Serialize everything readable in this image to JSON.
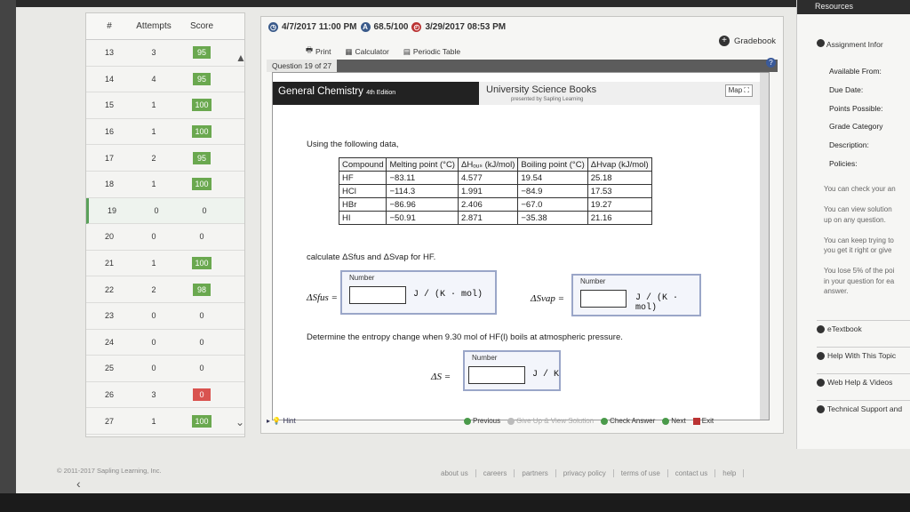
{
  "attempts_panel": {
    "headers": {
      "number": "#",
      "attempts": "Attempts",
      "score": "Score"
    },
    "rows": [
      {
        "n": "13",
        "attempts": "3",
        "score": "95",
        "status": "green"
      },
      {
        "n": "14",
        "attempts": "4",
        "score": "95",
        "status": "green"
      },
      {
        "n": "15",
        "attempts": "1",
        "score": "100",
        "status": "green"
      },
      {
        "n": "16",
        "attempts": "1",
        "score": "100",
        "status": "green"
      },
      {
        "n": "17",
        "attempts": "2",
        "score": "95",
        "status": "green"
      },
      {
        "n": "18",
        "attempts": "1",
        "score": "100",
        "status": "green"
      },
      {
        "n": "19",
        "attempts": "0",
        "score": "0",
        "status": "none"
      },
      {
        "n": "20",
        "attempts": "0",
        "score": "0",
        "status": "none"
      },
      {
        "n": "21",
        "attempts": "1",
        "score": "100",
        "status": "green"
      },
      {
        "n": "22",
        "attempts": "2",
        "score": "98",
        "status": "green"
      },
      {
        "n": "23",
        "attempts": "0",
        "score": "0",
        "status": "none"
      },
      {
        "n": "24",
        "attempts": "0",
        "score": "0",
        "status": "none"
      },
      {
        "n": "25",
        "attempts": "0",
        "score": "0",
        "status": "none"
      },
      {
        "n": "26",
        "attempts": "3",
        "score": "0",
        "status": "red"
      },
      {
        "n": "27",
        "attempts": "1",
        "score": "100",
        "status": "green"
      }
    ]
  },
  "question_header": {
    "due_date": "4/7/2017 11:00 PM",
    "score": "68.5/100",
    "last_date": "3/29/2017 08:53 PM",
    "print": "Print",
    "calculator": "Calculator",
    "periodic_table": "Periodic Table",
    "gradebook": "Gradebook",
    "question_label": "Question 19 of 27"
  },
  "book": {
    "title": "General Chemistry",
    "edition": "4th Edition",
    "publisher": "University Science Books",
    "publisher_sub": "presented by Sapling Learning",
    "map": "Map"
  },
  "question": {
    "intro": "Using the following data,",
    "table_headers": [
      "Compound",
      "Melting point (°C)",
      "ΔHₒᵤₛ (kJ/mol)",
      "Boiling point (°C)",
      "ΔHvap (kJ/mol)"
    ],
    "table_rows": [
      [
        "HF",
        "−83.11",
        "4.577",
        "19.54",
        "25.18"
      ],
      [
        "HCl",
        "−114.3",
        "1.991",
        "−84.9",
        "17.53"
      ],
      [
        "HBr",
        "−86.96",
        "2.406",
        "−67.0",
        "19.27"
      ],
      [
        "HI",
        "−50.91",
        "2.871",
        "−35.38",
        "21.16"
      ]
    ],
    "calc_prompt": "calculate ΔSfus and ΔSvap for HF.",
    "number_label": "Number",
    "ds_fus_label": "ΔSfus =",
    "ds_vap_label": "ΔSvap =",
    "unit_jkmol": "J / (K · mol)",
    "entropy_prompt": "Determine the entropy change when 9.30 mol of HF(l) boils at atmospheric pressure.",
    "ds_label": "ΔS =",
    "unit_jk": "J / K",
    "input_value": ""
  },
  "nav": {
    "hint": "Hint",
    "previous": "Previous",
    "give_up": "Give Up & View Solution",
    "check": "Check Answer",
    "next": "Next",
    "exit": "Exit"
  },
  "resources": {
    "header": "Resources",
    "assignment_info": "Assignment Infor",
    "available_from": "Available From:",
    "due_date": "Due Date:",
    "points_possible": "Points Possible:",
    "grade_category": "Grade Category",
    "description": "Description:",
    "policies": "Policies:",
    "notes": [
      "You can check your an",
      "",
      "You can view solution",
      "up on any question.",
      "",
      "You can keep trying to",
      "you get it right or give",
      "",
      "You lose 5% of the poi",
      "in your question for ea",
      "answer."
    ],
    "etextbook": "eTextbook",
    "help_topic": "Help With This Topic",
    "web_help": "Web Help & Videos",
    "tech_support": "Technical Support and"
  },
  "footer": {
    "copyright": "© 2011-2017 Sapling Learning, Inc.",
    "links": [
      "about us",
      "careers",
      "partners",
      "privacy policy",
      "terms of use",
      "contact us",
      "help"
    ]
  }
}
